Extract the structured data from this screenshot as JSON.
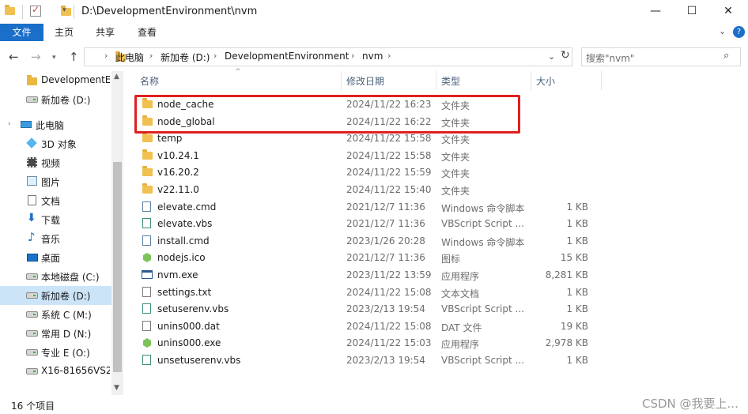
{
  "window": {
    "title": "D:\\DevelopmentEnvironment\\nvm",
    "minimize": "—",
    "maximize": "☐",
    "close": "✕"
  },
  "ribbon": {
    "tabs": [
      "文件",
      "主页",
      "共享",
      "查看"
    ],
    "expand": "⌄",
    "help": "?"
  },
  "address": {
    "crumbs": [
      "此电脑",
      "新加卷 (D:)",
      "DevelopmentEnvironment",
      "nvm"
    ],
    "separator": "›",
    "search_placeholder": "搜索\"nvm\""
  },
  "sidebar": {
    "items": [
      {
        "label": "DevelopmentEnvironment",
        "icon": "folder-icon"
      },
      {
        "label": "新加卷 (D:)",
        "icon": "drive-icon"
      },
      {
        "label": "此电脑",
        "icon": "computer-icon"
      },
      {
        "label": "3D 对象",
        "icon": "3d-objects-icon"
      },
      {
        "label": "视频",
        "icon": "videos-icon"
      },
      {
        "label": "图片",
        "icon": "pictures-icon"
      },
      {
        "label": "文档",
        "icon": "documents-icon"
      },
      {
        "label": "下载",
        "icon": "downloads-icon"
      },
      {
        "label": "音乐",
        "icon": "music-icon"
      },
      {
        "label": "桌面",
        "icon": "desktop-icon"
      },
      {
        "label": "本地磁盘 (C:)",
        "icon": "drive-icon"
      },
      {
        "label": "新加卷 (D:)",
        "icon": "drive-icon"
      },
      {
        "label": "系统 C (M:)",
        "icon": "network-drive-icon"
      },
      {
        "label": "常用 D (N:)",
        "icon": "network-drive-icon"
      },
      {
        "label": "专业 E (O:)",
        "icon": "network-drive-icon"
      },
      {
        "label": "X16-81656VS2",
        "icon": "network-drive-icon"
      }
    ],
    "selected_index": 11
  },
  "columns": {
    "name": "名称",
    "date": "修改日期",
    "type": "类型",
    "size": "大小"
  },
  "files": [
    {
      "name": "node_cache",
      "date": "2024/11/22 16:23",
      "type": "文件夹",
      "size": "",
      "icon": "folder-icon"
    },
    {
      "name": "node_global",
      "date": "2024/11/22 16:22",
      "type": "文件夹",
      "size": "",
      "icon": "folder-icon"
    },
    {
      "name": "temp",
      "date": "2024/11/22 15:58",
      "type": "文件夹",
      "size": "",
      "icon": "folder-icon"
    },
    {
      "name": "v10.24.1",
      "date": "2024/11/22 15:58",
      "type": "文件夹",
      "size": "",
      "icon": "folder-icon"
    },
    {
      "name": "v16.20.2",
      "date": "2024/11/22 15:59",
      "type": "文件夹",
      "size": "",
      "icon": "folder-icon"
    },
    {
      "name": "v22.11.0",
      "date": "2024/11/22 15:40",
      "type": "文件夹",
      "size": "",
      "icon": "folder-icon"
    },
    {
      "name": "elevate.cmd",
      "date": "2021/12/7 11:36",
      "type": "Windows 命令脚本",
      "size": "1 KB",
      "icon": "cmd-file-icon"
    },
    {
      "name": "elevate.vbs",
      "date": "2021/12/7 11:36",
      "type": "VBScript Script ...",
      "size": "1 KB",
      "icon": "vbs-file-icon"
    },
    {
      "name": "install.cmd",
      "date": "2023/1/26 20:28",
      "type": "Windows 命令脚本",
      "size": "1 KB",
      "icon": "cmd-file-icon"
    },
    {
      "name": "nodejs.ico",
      "date": "2021/12/7 11:36",
      "type": "图标",
      "size": "15 KB",
      "icon": "nodejs-icon"
    },
    {
      "name": "nvm.exe",
      "date": "2023/11/22 13:59",
      "type": "应用程序",
      "size": "8,281 KB",
      "icon": "exe-file-icon"
    },
    {
      "name": "settings.txt",
      "date": "2024/11/22 15:08",
      "type": "文本文档",
      "size": "1 KB",
      "icon": "txt-file-icon"
    },
    {
      "name": "setuserenv.vbs",
      "date": "2023/2/13 19:54",
      "type": "VBScript Script ...",
      "size": "1 KB",
      "icon": "vbs-file-icon"
    },
    {
      "name": "unins000.dat",
      "date": "2024/11/22 15:08",
      "type": "DAT 文件",
      "size": "19 KB",
      "icon": "dat-file-icon"
    },
    {
      "name": "unins000.exe",
      "date": "2024/11/22 15:03",
      "type": "应用程序",
      "size": "2,978 KB",
      "icon": "nodejs-icon"
    },
    {
      "name": "unsetuserenv.vbs",
      "date": "2023/2/13 19:54",
      "type": "VBScript Script ...",
      "size": "1 KB",
      "icon": "vbs-file-icon"
    }
  ],
  "status": {
    "count": "16 个项目"
  },
  "watermark": "CSDN @我要上..."
}
